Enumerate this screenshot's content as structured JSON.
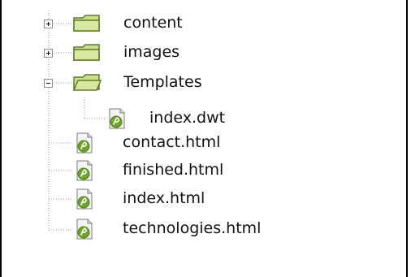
{
  "tree": {
    "folders": [
      {
        "label": "content",
        "expanded": false
      },
      {
        "label": "images",
        "expanded": false
      },
      {
        "label": "Templates",
        "expanded": true,
        "children": [
          {
            "label": "index.dwt"
          }
        ]
      }
    ],
    "files": [
      {
        "label": "contact.html"
      },
      {
        "label": "finished.html"
      },
      {
        "label": "index.html"
      },
      {
        "label": "technologies.html"
      }
    ]
  },
  "colors": {
    "folder_fill": "#c9df8a",
    "folder_border": "#5f7d22",
    "file_icon_green": "#6fa527",
    "guide_line": "#9a9a9a"
  },
  "icons": {
    "folder": "folder-icon",
    "file": "dreamweaver-file-icon",
    "expander": "expand-collapse-icon"
  }
}
